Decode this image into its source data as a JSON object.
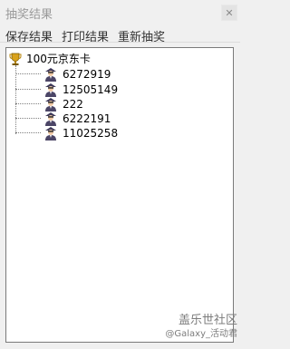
{
  "window": {
    "title": "抽奖结果",
    "close_symbol": "✕"
  },
  "menu": [
    {
      "label": "保存结果"
    },
    {
      "label": "打印结果"
    },
    {
      "label": "重新抽奖"
    }
  ],
  "tree": {
    "root": {
      "label": "100元京东卡",
      "icon": "trophy-icon"
    },
    "winners": [
      {
        "label": "6272919",
        "icon": "user-icon"
      },
      {
        "label": "12505149",
        "icon": "user-icon"
      },
      {
        "label": "222",
        "icon": "user-icon"
      },
      {
        "label": "6222191",
        "icon": "user-icon"
      },
      {
        "label": "11025258",
        "icon": "user-icon"
      }
    ]
  },
  "watermark": {
    "logo_text": "盖乐世社区",
    "handle": "@Galaxy_活动君"
  },
  "colors": {
    "background": "#f0f0f0",
    "panel": "#ffffff",
    "title_text": "#9a9a9a"
  }
}
